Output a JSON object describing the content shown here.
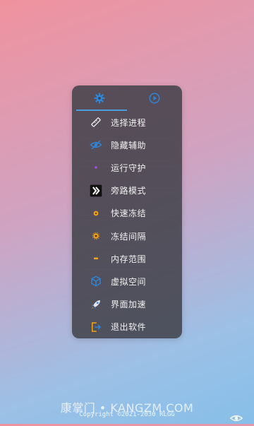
{
  "tabs": [
    {
      "icon": "settings-cog-icon",
      "active": true
    },
    {
      "icon": "play-circle-icon",
      "active": false
    }
  ],
  "menu": [
    {
      "label": "选择进程",
      "icon": "ruler-pencil-icon"
    },
    {
      "label": "隐藏辅助",
      "icon": "eye-hide-icon"
    },
    {
      "label": "运行守护",
      "icon": "dot-purple-icon"
    },
    {
      "label": "旁路模式",
      "icon": "bypass-chevrons-icon"
    },
    {
      "label": "快速冻结",
      "icon": "snowflake-fast-icon"
    },
    {
      "label": "冻结间隔",
      "icon": "snowflake-interval-icon"
    },
    {
      "label": "内存范围",
      "icon": "memory-range-icon"
    },
    {
      "label": "虚拟空间",
      "icon": "cube-icon"
    },
    {
      "label": "界面加速",
      "icon": "rocket-icon"
    },
    {
      "label": "退出软件",
      "icon": "exit-icon"
    }
  ],
  "footer": {
    "copyright": "Copyright ©2021-2030 RLGG",
    "watermark": "康掌门 • KANGZM.COM"
  },
  "colors": {
    "accent": "#4b9ddd",
    "panel": "#404048"
  }
}
